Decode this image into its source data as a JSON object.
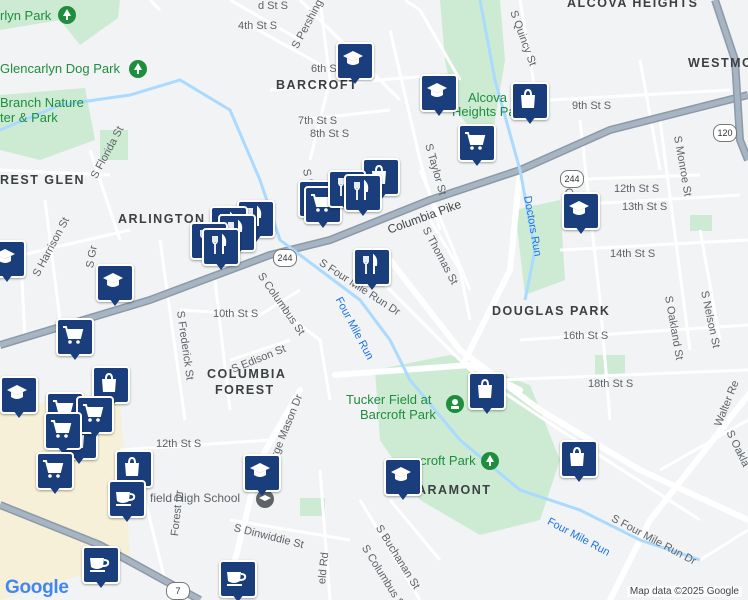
{
  "map": {
    "neighborhoods": [
      "ALCOVA HEIGHTS",
      "WESTMO",
      "BARCROFT",
      "REST GLEN",
      "ARLINGTON",
      "DOUGLAS PARK",
      "COLUMBIA",
      "FOREST",
      "ARAMONT"
    ],
    "parks": [
      "rlyn Park",
      "Glencarlyn Dog Park",
      "Branch Nature",
      "ter & Park",
      "Alcova",
      "Heights Park",
      "Tucker Field at",
      "Barcroft Park",
      "croft Park"
    ],
    "waterways": [
      "Four Mile Run",
      "Doctors Run",
      "Four Mile Run"
    ],
    "streets": {
      "top": [
        "d St S",
        "S Pershing",
        "4th St S",
        "6th St",
        "7th St S",
        "8th St S",
        "S Quincy St",
        "9th St S",
        "S Taylor St",
        "S Thomas St",
        "S B",
        "12th St S",
        "13th St S",
        "14th St S",
        "Columbia Pike",
        "S Qui",
        "S Four Mile Run Dr",
        "S Monroe St"
      ],
      "mid": [
        "S Florida St",
        "S Harrison St",
        "S Gr",
        "S Columbus St",
        "10th St S",
        "S Edison St",
        "S Frederick St",
        "16th St S",
        "S Oakland St",
        "S Nelson St",
        "18th St S",
        "Walter Re",
        "S Oakla"
      ],
      "bottom": [
        "12th St S",
        "George Mason Dr",
        "field High School",
        "S Dinwiddie St",
        "Forest Dr",
        "S Buchanan St",
        "S Columbus St",
        "S Four Mile Run Dr",
        "eld Rd"
      ]
    },
    "shields": [
      "244",
      "120",
      "244",
      "7"
    ],
    "logo": "Google",
    "attribution": "Map data ©2025 Google"
  },
  "icons": {
    "school": "graduation-cap-icon",
    "grocery": "shopping-cart-icon",
    "shopping": "shopping-bag-icon",
    "restaurant": "fork-knife-icon",
    "cafe": "coffee-cup-icon",
    "park": "tree-icon",
    "pin_color": "#1a3d7c"
  }
}
